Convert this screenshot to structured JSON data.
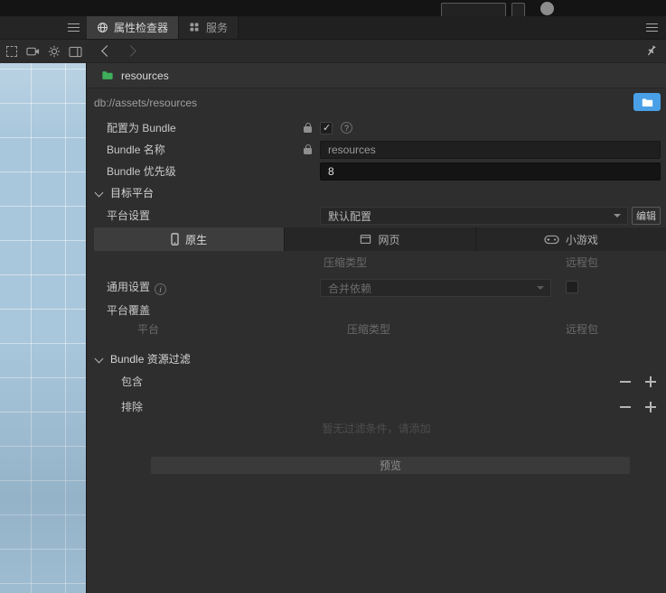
{
  "inspector": {
    "tabs": [
      {
        "icon": "globe-icon",
        "label": "属性检查器"
      },
      {
        "icon": "grid-icon",
        "label": "服务"
      }
    ],
    "asset": {
      "icon": "folder-icon",
      "name": "resources",
      "path": "db://assets/resources"
    },
    "bundle": {
      "config_label": "配置为 Bundle",
      "config_checked": true,
      "name_label": "Bundle 名称",
      "name_value": "resources",
      "priority_label": "Bundle 优先级",
      "priority_value": "8"
    },
    "target_platform": {
      "section_label": "目标平台",
      "platform_setting_label": "平台设置",
      "platform_setting_value": "默认配置",
      "edit_button": "编辑",
      "tabs": [
        {
          "icon": "phone-icon",
          "label": "原生",
          "active": true
        },
        {
          "icon": "browser-icon",
          "label": "网页",
          "active": false
        },
        {
          "icon": "gamepad-icon",
          "label": "小游戏",
          "active": false
        }
      ],
      "compression_header": "压缩类型",
      "remote_header": "远程包",
      "general_label": "通用设置",
      "merge_value": "合并依赖",
      "remote_checked": false,
      "override_label": "平台覆盖",
      "table": {
        "platform": "平台",
        "compression": "压缩类型",
        "remote": "远程包"
      }
    },
    "filter": {
      "section_label": "Bundle 资源过滤",
      "include_label": "包含",
      "exclude_label": "排除",
      "empty_text": "暂无过滤条件，请添加",
      "preview_button": "预览"
    }
  },
  "icons": {
    "panel_menu": "hamburger-icon",
    "back": "chevron-left-icon",
    "forward": "chevron-right-icon",
    "pin": "pin-icon",
    "locate": "folder-open-icon",
    "lock": "lock-icon",
    "help": "question-icon",
    "info": "info-icon",
    "remove": "minus-icon",
    "add": "plus-icon",
    "scene_toolbar": [
      "marquee-icon",
      "camera-icon",
      "gear-icon",
      "layout-icon"
    ]
  },
  "colors": {
    "accent_blue": "#4aa0e6",
    "folder_green": "#3fae5c",
    "panel_bg": "#2e2e2e"
  }
}
